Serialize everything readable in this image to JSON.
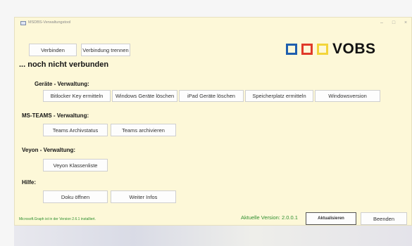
{
  "window": {
    "title": "MSDBS-Verwaltungstool",
    "controls": [
      "–",
      "□",
      "×"
    ]
  },
  "connection": {
    "connect_label": "Verbinden",
    "disconnect_label": "Verbindung trennen",
    "status": "... noch nicht verbunden"
  },
  "logo": {
    "text": "VOBS",
    "square_colors": [
      "#1f5fae",
      "#e03a2a",
      "#f3d53a"
    ]
  },
  "sections": {
    "devices": {
      "title": "Geräte - Verwaltung:",
      "buttons": [
        "Bitlocker Key ermitteln",
        "Windows Geräte löschen",
        "iPad Geräte löschen",
        "Speicherplatz ermitteln",
        "Windowsversion"
      ]
    },
    "teams": {
      "title": "MS-TEAMS - Verwaltung:",
      "buttons": [
        "Teams Archivstatus",
        "Teams archivieren"
      ]
    },
    "veyon": {
      "title": "Veyon - Verwaltung:",
      "buttons": [
        "Veyon Klassenliste"
      ]
    },
    "help": {
      "title": "Hilfe:",
      "buttons": [
        "Doku öffnen",
        "Weiter Infos"
      ]
    }
  },
  "footer": {
    "graph_note": "Microsoft.Graph ist in der Version 2.6.1 installiert.",
    "version_text": "Aktuelle Version: 2.0.0.1",
    "update_label": "Aktualisieren",
    "close_label": "Beenden"
  }
}
